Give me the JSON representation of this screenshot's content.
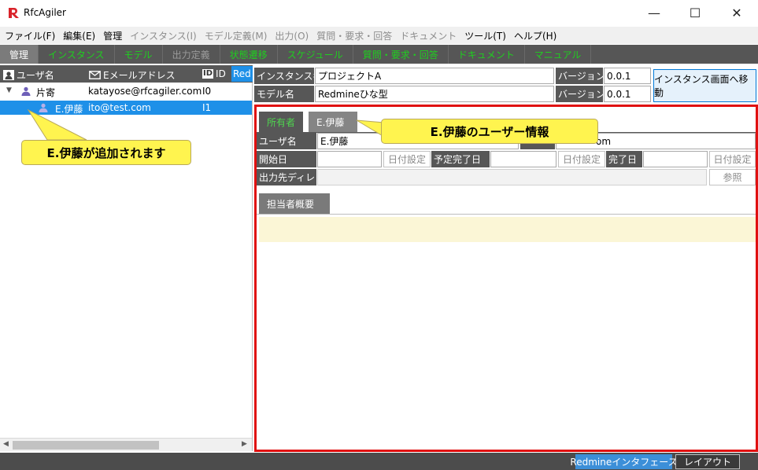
{
  "window": {
    "title": "RfcAgiler",
    "minimize": "—",
    "maximize": "☐",
    "close": "✕"
  },
  "menu": [
    {
      "label": "ファイル(F)",
      "enabled": true
    },
    {
      "label": "編集(E)",
      "enabled": true
    },
    {
      "label": "管理",
      "enabled": true
    },
    {
      "label": "インスタンス(I)",
      "enabled": false
    },
    {
      "label": "モデル定義(M)",
      "enabled": false
    },
    {
      "label": "出力(O)",
      "enabled": false
    },
    {
      "label": "質問・要求・回答",
      "enabled": false
    },
    {
      "label": "ドキュメント",
      "enabled": false
    },
    {
      "label": "ツール(T)",
      "enabled": true
    },
    {
      "label": "ヘルプ(H)",
      "enabled": true
    }
  ],
  "tabs": [
    {
      "label": "管理",
      "style": "active"
    },
    {
      "label": "インスタンス",
      "style": "green"
    },
    {
      "label": "モデル",
      "style": "green"
    },
    {
      "label": "出力定義",
      "style": "gray"
    },
    {
      "label": "状態遷移",
      "style": "green"
    },
    {
      "label": "スケジュール",
      "style": "green"
    },
    {
      "label": "質問・要求・回答",
      "style": "green"
    },
    {
      "label": "ドキュメント",
      "style": "green"
    },
    {
      "label": "マニュアル",
      "style": "green"
    }
  ],
  "tree": {
    "headers": {
      "user_name": "ユーザ名",
      "email": "Eメールアドレス",
      "id_icon": "ID",
      "id": "ID",
      "red": "Red"
    },
    "rows": [
      {
        "name": "片寄",
        "email": "katayose@rfcagiler.com",
        "id": "I0"
      },
      {
        "name": "E.伊藤",
        "email": "ito@test.com",
        "id": "I1"
      }
    ]
  },
  "instance": {
    "name_label": "インスタンス名",
    "name_value": "プロジェクトA",
    "version_label": "バージョン",
    "version_value": "0.0.1",
    "model_label": "モデル名",
    "model_value": "Redmineひな型",
    "model_version_label": "バージョン",
    "model_version_value": "0.0.1",
    "goto_button": "インスタンス画面へ移動"
  },
  "detail": {
    "tab_owner": "所有者",
    "tab_user": "E.伊藤",
    "username_label": "ユーザ名",
    "username_value": "E.伊藤",
    "email_value_partial": "om",
    "start_label": "開始日",
    "date_set_1": "日付設定",
    "planned_end_label": "予定完了日",
    "date_set_2": "日付設定",
    "end_label": "完了日",
    "date_set_3": "日付設定",
    "output_dir_label": "出力先ディレ",
    "browse_button": "参照",
    "summary_tab": "担当者概要"
  },
  "callouts": {
    "added": "E.伊藤が追加されます",
    "user_info": "E.伊藤のユーザー情報"
  },
  "status": {
    "redmine_button": "Redmineインタフェース",
    "layout_button": "レイアウト"
  },
  "colors": {
    "selection": "#1e90e8",
    "callout": "#fff44f",
    "highlight_border": "#e01010",
    "tab_green": "#1fcf1f"
  }
}
